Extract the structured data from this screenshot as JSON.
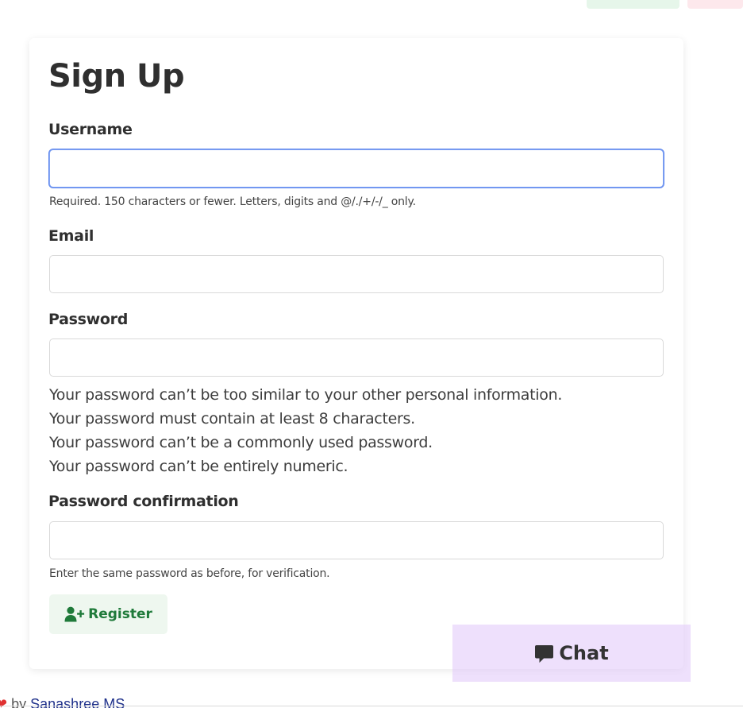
{
  "form": {
    "title": "Sign Up",
    "fields": [
      {
        "label": "Username",
        "value": "",
        "help": "Required. 150 characters or fewer. Letters, digits and @/./+/-/_ only."
      },
      {
        "label": "Email",
        "value": ""
      },
      {
        "label": "Password",
        "value": ""
      },
      {
        "label": "Password confirmation",
        "value": "",
        "help": "Enter the same password as before, for verification."
      }
    ],
    "password_help": [
      "Your password can’t be too similar to your other personal information.",
      "Your password must contain at least 8 characters.",
      "Your password can’t be a commonly used password.",
      "Your password can’t be entirely numeric."
    ],
    "register_label": "Register",
    "register_icon": "user-plus-icon"
  },
  "chat": {
    "label": "Chat",
    "icon": "comment-icon",
    "background": "#e2cbfa"
  },
  "footer": {
    "prefix": "by",
    "author": "Sanashree MS"
  },
  "colors": {
    "focus": "#5b84ee",
    "register_text": "#1f7a3a",
    "register_bg": "#eef7ef"
  }
}
